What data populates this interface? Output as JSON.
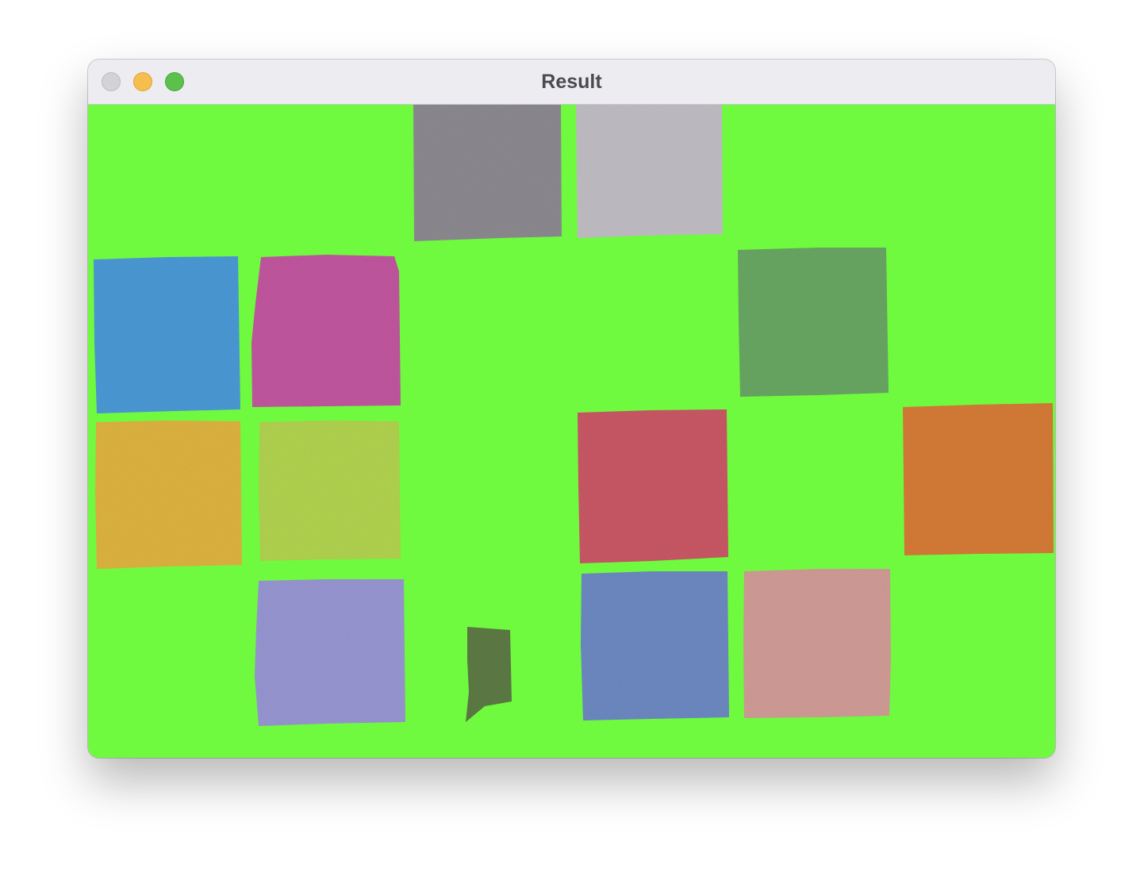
{
  "window": {
    "title": "Result"
  },
  "colors": {
    "background_green": "#6ffa3f",
    "titlebar": "#edecf1",
    "close": "#d3d2d7",
    "minimize": "#f6be4f",
    "zoom": "#5cc14b"
  },
  "patches": [
    {
      "name": "gray-patch",
      "color": "#8e8c92"
    },
    {
      "name": "light-gray-patch",
      "color": "#c2c0c6"
    },
    {
      "name": "blue-patch",
      "color": "#4e9bd8"
    },
    {
      "name": "magenta-patch",
      "color": "#c458a1"
    },
    {
      "name": "green-patch",
      "color": "#6aa965"
    },
    {
      "name": "yellow-orange-patch",
      "color": "#e0b643"
    },
    {
      "name": "yellow-green-patch",
      "color": "#b3d551"
    },
    {
      "name": "red-patch",
      "color": "#cc5a68"
    },
    {
      "name": "orange-patch",
      "color": "#d87d37"
    },
    {
      "name": "lavender-patch",
      "color": "#9a98d4"
    },
    {
      "name": "dark-green-patch",
      "color": "#5f7d47"
    },
    {
      "name": "slate-blue-patch",
      "color": "#6e8bc4"
    },
    {
      "name": "pink-patch",
      "color": "#d39e98"
    }
  ]
}
